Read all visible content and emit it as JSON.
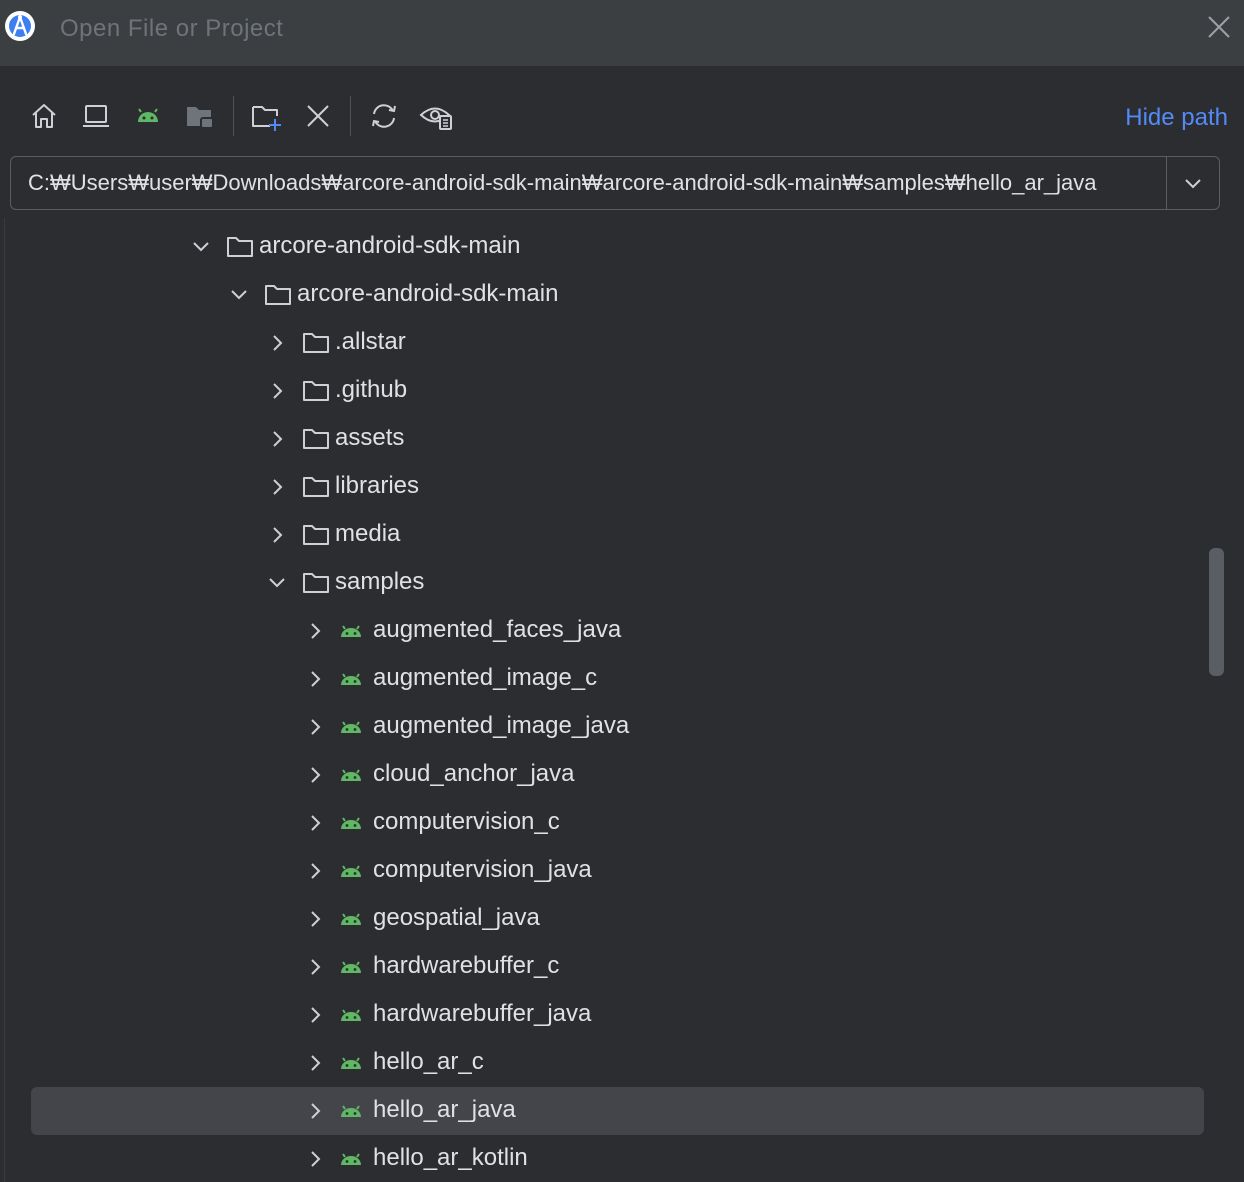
{
  "window": {
    "title": "Open File or Project"
  },
  "toolbar": {
    "hide_path_label": "Hide path"
  },
  "path": {
    "value": "C:₩Users₩user₩Downloads₩arcore-android-sdk-main₩arcore-android-sdk-main₩samples₩hello_ar_java"
  },
  "colors": {
    "accent": "#548af7",
    "android_green": "#5fb865",
    "background": "#2b2d30",
    "selected_row": "#43454a"
  },
  "tree": [
    {
      "label": "arcore-android-sdk-main",
      "depth": 0,
      "expanded": true,
      "icon": "folder-icon"
    },
    {
      "label": "arcore-android-sdk-main",
      "depth": 1,
      "expanded": true,
      "icon": "folder-icon"
    },
    {
      "label": ".allstar",
      "depth": 2,
      "expanded": false,
      "icon": "folder-icon"
    },
    {
      "label": ".github",
      "depth": 2,
      "expanded": false,
      "icon": "folder-icon"
    },
    {
      "label": "assets",
      "depth": 2,
      "expanded": false,
      "icon": "folder-icon"
    },
    {
      "label": "libraries",
      "depth": 2,
      "expanded": false,
      "icon": "folder-icon"
    },
    {
      "label": "media",
      "depth": 2,
      "expanded": false,
      "icon": "folder-icon"
    },
    {
      "label": "samples",
      "depth": 2,
      "expanded": true,
      "icon": "folder-icon"
    },
    {
      "label": "augmented_faces_java",
      "depth": 3,
      "expanded": false,
      "icon": "android-icon"
    },
    {
      "label": "augmented_image_c",
      "depth": 3,
      "expanded": false,
      "icon": "android-icon"
    },
    {
      "label": "augmented_image_java",
      "depth": 3,
      "expanded": false,
      "icon": "android-icon"
    },
    {
      "label": "cloud_anchor_java",
      "depth": 3,
      "expanded": false,
      "icon": "android-icon"
    },
    {
      "label": "computervision_c",
      "depth": 3,
      "expanded": false,
      "icon": "android-icon"
    },
    {
      "label": "computervision_java",
      "depth": 3,
      "expanded": false,
      "icon": "android-icon"
    },
    {
      "label": "geospatial_java",
      "depth": 3,
      "expanded": false,
      "icon": "android-icon"
    },
    {
      "label": "hardwarebuffer_c",
      "depth": 3,
      "expanded": false,
      "icon": "android-icon"
    },
    {
      "label": "hardwarebuffer_java",
      "depth": 3,
      "expanded": false,
      "icon": "android-icon"
    },
    {
      "label": "hello_ar_c",
      "depth": 3,
      "expanded": false,
      "icon": "android-icon"
    },
    {
      "label": "hello_ar_java",
      "depth": 3,
      "expanded": false,
      "icon": "android-icon",
      "selected": true
    },
    {
      "label": "hello_ar_kotlin",
      "depth": 3,
      "expanded": false,
      "icon": "android-icon"
    }
  ]
}
